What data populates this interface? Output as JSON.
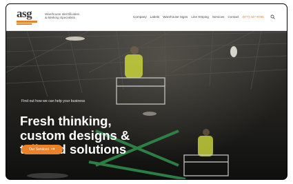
{
  "header": {
    "logo_text": "asg",
    "tagline_line1": "Warehouse Identification",
    "tagline_line2": "& Marking Specialists",
    "nav_items": [
      "Company",
      "Labels",
      "Warehouse Signs",
      "Line Striping",
      "Services",
      "Contact"
    ],
    "phone": "(877) 447-8786",
    "search_icon": "search-icon"
  },
  "hero": {
    "eyebrow": "Find out how we can help your business",
    "headline_line1": "Fresh thinking,",
    "headline_line2": "custom designs &",
    "headline_line3": "tailored solutions",
    "cta_label": "Our Services",
    "cta_icon": "arrow-right-icon"
  },
  "colors": {
    "accent": "#e9822a",
    "header_bg": "#ffffff",
    "headline_text": "#ffffff"
  }
}
